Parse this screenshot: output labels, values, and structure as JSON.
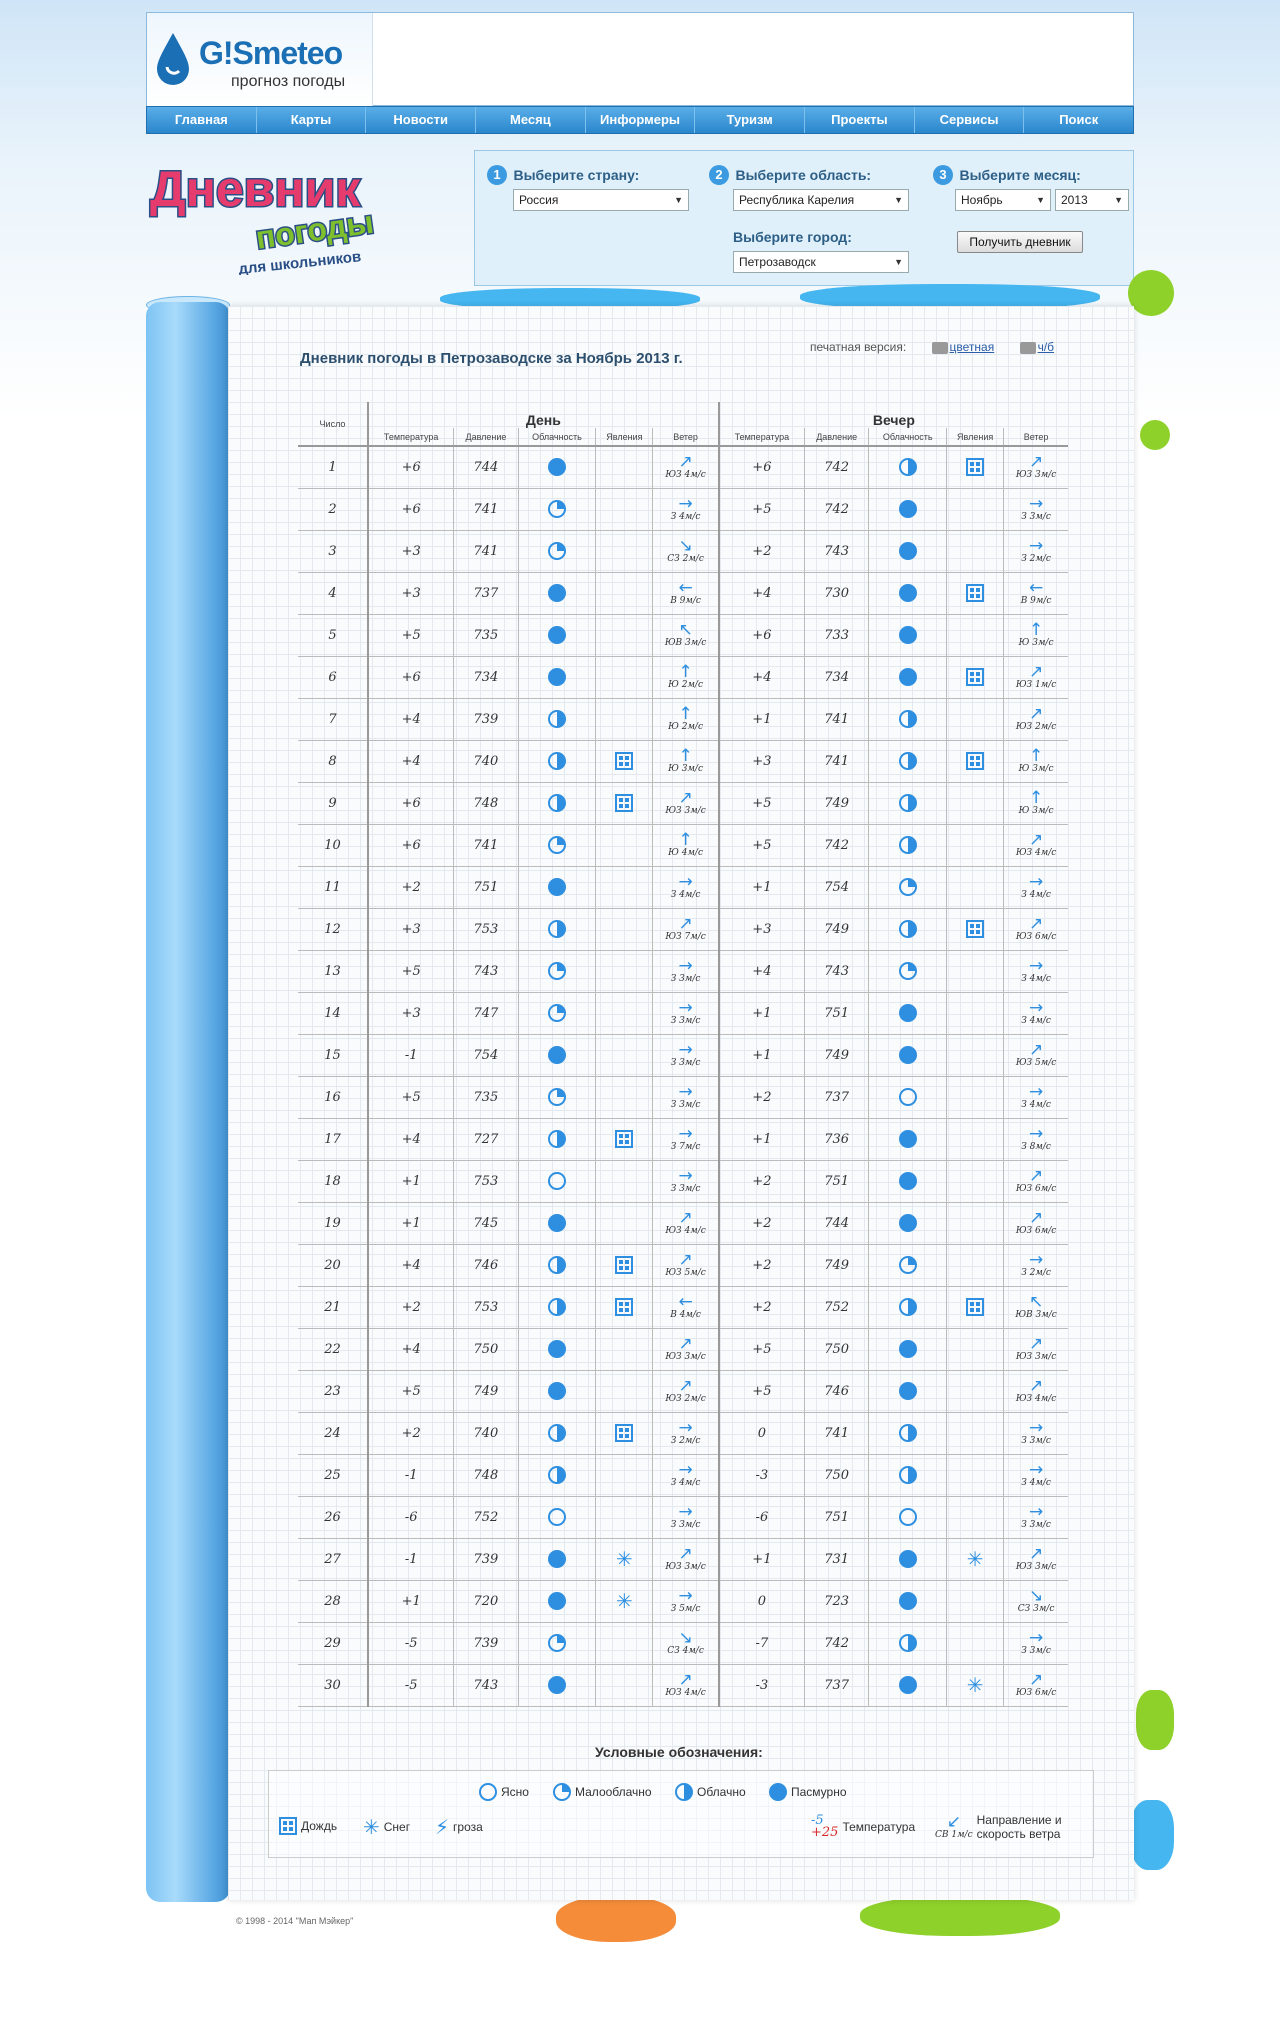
{
  "header": {
    "logo_name": "GISMETEO",
    "logo_brand": "G!Smeteo",
    "logo_sub": "прогноз погоды"
  },
  "nav": [
    "Главная",
    "Карты",
    "Новости",
    "Месяц",
    "Информеры",
    "Туризм",
    "Проекты",
    "Сервисы",
    "Поиск"
  ],
  "diary_logo": {
    "line1": "Дневник",
    "line2": "погоды",
    "line3": "для школьников"
  },
  "selector": {
    "country": {
      "num": "1",
      "title": "Выберите страну:",
      "value": "Россия"
    },
    "region": {
      "num": "2",
      "title": "Выберите область:",
      "value": "Республика Карелия"
    },
    "city": {
      "title": "Выберите город:",
      "value": "Петрозаводск"
    },
    "month": {
      "num": "3",
      "title": "Выберите месяц:",
      "month_value": "Ноябрь",
      "year_value": "2013"
    },
    "submit_label": "Получить дневник"
  },
  "diary": {
    "title": "Дневник погоды в Петрозаводске за Ноябрь 2013 г.",
    "print_label": "печатная версия:",
    "print_color": "цветная",
    "print_bw": "ч/б",
    "col_day": "Число",
    "group_day": "День",
    "group_evening": "Вечер",
    "col_temp": "Температура",
    "col_pressure": "Давление",
    "col_cloud": "Облачность",
    "col_phen": "Явления",
    "col_wind": "Ветер",
    "rows": [
      {
        "d": "1",
        "t1": "+6",
        "p1": "744",
        "c1": "over",
        "ph1": "",
        "w1": "ЮЗ 4м/с",
        "a1": "ne",
        "t2": "+6",
        "p2": "742",
        "c2": "half",
        "ph2": "rain",
        "w2": "ЮЗ 3м/с",
        "a2": "ne"
      },
      {
        "d": "2",
        "t1": "+6",
        "p1": "741",
        "c1": "few",
        "ph1": "",
        "w1": "З 4м/с",
        "a1": "e",
        "t2": "+5",
        "p2": "742",
        "c2": "over",
        "ph2": "",
        "w2": "З 3м/с",
        "a2": "e"
      },
      {
        "d": "3",
        "t1": "+3",
        "p1": "741",
        "c1": "few",
        "ph1": "",
        "w1": "СЗ 2м/с",
        "a1": "se",
        "t2": "+2",
        "p2": "743",
        "c2": "over",
        "ph2": "",
        "w2": "З 2м/с",
        "a2": "e"
      },
      {
        "d": "4",
        "t1": "+3",
        "p1": "737",
        "c1": "over",
        "ph1": "",
        "w1": "В 9м/с",
        "a1": "w",
        "t2": "+4",
        "p2": "730",
        "c2": "over",
        "ph2": "rain",
        "w2": "В 9м/с",
        "a2": "w"
      },
      {
        "d": "5",
        "t1": "+5",
        "p1": "735",
        "c1": "over",
        "ph1": "",
        "w1": "ЮВ 3м/с",
        "a1": "nw",
        "t2": "+6",
        "p2": "733",
        "c2": "over",
        "ph2": "",
        "w2": "Ю 3м/с",
        "a2": "n"
      },
      {
        "d": "6",
        "t1": "+6",
        "p1": "734",
        "c1": "over",
        "ph1": "",
        "w1": "Ю 2м/с",
        "a1": "n",
        "t2": "+4",
        "p2": "734",
        "c2": "over",
        "ph2": "rain",
        "w2": "ЮЗ 1м/с",
        "a2": "ne"
      },
      {
        "d": "7",
        "t1": "+4",
        "p1": "739",
        "c1": "half",
        "ph1": "",
        "w1": "Ю 2м/с",
        "a1": "n",
        "t2": "+1",
        "p2": "741",
        "c2": "half",
        "ph2": "",
        "w2": "ЮЗ 2м/с",
        "a2": "ne"
      },
      {
        "d": "8",
        "t1": "+4",
        "p1": "740",
        "c1": "half",
        "ph1": "rain",
        "w1": "Ю 3м/с",
        "a1": "n",
        "t2": "+3",
        "p2": "741",
        "c2": "half",
        "ph2": "rain",
        "w2": "Ю 3м/с",
        "a2": "n"
      },
      {
        "d": "9",
        "t1": "+6",
        "p1": "748",
        "c1": "half",
        "ph1": "rain",
        "w1": "ЮЗ 3м/с",
        "a1": "ne",
        "t2": "+5",
        "p2": "749",
        "c2": "half",
        "ph2": "",
        "w2": "Ю 3м/с",
        "a2": "n"
      },
      {
        "d": "10",
        "t1": "+6",
        "p1": "741",
        "c1": "few",
        "ph1": "",
        "w1": "Ю 4м/с",
        "a1": "n",
        "t2": "+5",
        "p2": "742",
        "c2": "half",
        "ph2": "",
        "w2": "ЮЗ 4м/с",
        "a2": "ne"
      },
      {
        "d": "11",
        "t1": "+2",
        "p1": "751",
        "c1": "over",
        "ph1": "",
        "w1": "З 4м/с",
        "a1": "e",
        "t2": "+1",
        "p2": "754",
        "c2": "few",
        "ph2": "",
        "w2": "З 4м/с",
        "a2": "e"
      },
      {
        "d": "12",
        "t1": "+3",
        "p1": "753",
        "c1": "half",
        "ph1": "",
        "w1": "ЮЗ 7м/с",
        "a1": "ne",
        "t2": "+3",
        "p2": "749",
        "c2": "half",
        "ph2": "rain",
        "w2": "ЮЗ 6м/с",
        "a2": "ne"
      },
      {
        "d": "13",
        "t1": "+5",
        "p1": "743",
        "c1": "few",
        "ph1": "",
        "w1": "З 3м/с",
        "a1": "e",
        "t2": "+4",
        "p2": "743",
        "c2": "few",
        "ph2": "",
        "w2": "З 4м/с",
        "a2": "e"
      },
      {
        "d": "14",
        "t1": "+3",
        "p1": "747",
        "c1": "few",
        "ph1": "",
        "w1": "З 3м/с",
        "a1": "e",
        "t2": "+1",
        "p2": "751",
        "c2": "over",
        "ph2": "",
        "w2": "З 4м/с",
        "a2": "e"
      },
      {
        "d": "15",
        "t1": "-1",
        "p1": "754",
        "c1": "over",
        "ph1": "",
        "w1": "З 3м/с",
        "a1": "e",
        "t2": "+1",
        "p2": "749",
        "c2": "over",
        "ph2": "",
        "w2": "ЮЗ 5м/с",
        "a2": "ne"
      },
      {
        "d": "16",
        "t1": "+5",
        "p1": "735",
        "c1": "few",
        "ph1": "",
        "w1": "З 3м/с",
        "a1": "e",
        "t2": "+2",
        "p2": "737",
        "c2": "clear",
        "ph2": "",
        "w2": "З 4м/с",
        "a2": "e"
      },
      {
        "d": "17",
        "t1": "+4",
        "p1": "727",
        "c1": "half",
        "ph1": "rain",
        "w1": "З 7м/с",
        "a1": "e",
        "t2": "+1",
        "p2": "736",
        "c2": "over",
        "ph2": "",
        "w2": "З 8м/с",
        "a2": "e"
      },
      {
        "d": "18",
        "t1": "+1",
        "p1": "753",
        "c1": "clear",
        "ph1": "",
        "w1": "З 3м/с",
        "a1": "e",
        "t2": "+2",
        "p2": "751",
        "c2": "over",
        "ph2": "",
        "w2": "ЮЗ 6м/с",
        "a2": "ne"
      },
      {
        "d": "19",
        "t1": "+1",
        "p1": "745",
        "c1": "over",
        "ph1": "",
        "w1": "ЮЗ 4м/с",
        "a1": "ne",
        "t2": "+2",
        "p2": "744",
        "c2": "over",
        "ph2": "",
        "w2": "ЮЗ 6м/с",
        "a2": "ne"
      },
      {
        "d": "20",
        "t1": "+4",
        "p1": "746",
        "c1": "half",
        "ph1": "rain",
        "w1": "ЮЗ 5м/с",
        "a1": "ne",
        "t2": "+2",
        "p2": "749",
        "c2": "few",
        "ph2": "",
        "w2": "З 2м/с",
        "a2": "e"
      },
      {
        "d": "21",
        "t1": "+2",
        "p1": "753",
        "c1": "half",
        "ph1": "rain",
        "w1": "В 4м/с",
        "a1": "w",
        "t2": "+2",
        "p2": "752",
        "c2": "half",
        "ph2": "rain",
        "w2": "ЮВ 3м/с",
        "a2": "nw"
      },
      {
        "d": "22",
        "t1": "+4",
        "p1": "750",
        "c1": "over",
        "ph1": "",
        "w1": "ЮЗ 3м/с",
        "a1": "ne",
        "t2": "+5",
        "p2": "750",
        "c2": "over",
        "ph2": "",
        "w2": "ЮЗ 3м/с",
        "a2": "ne"
      },
      {
        "d": "23",
        "t1": "+5",
        "p1": "749",
        "c1": "over",
        "ph1": "",
        "w1": "ЮЗ 2м/с",
        "a1": "ne",
        "t2": "+5",
        "p2": "746",
        "c2": "over",
        "ph2": "",
        "w2": "ЮЗ 4м/с",
        "a2": "ne"
      },
      {
        "d": "24",
        "t1": "+2",
        "p1": "740",
        "c1": "half",
        "ph1": "rain",
        "w1": "З 2м/с",
        "a1": "e",
        "t2": "0",
        "p2": "741",
        "c2": "half",
        "ph2": "",
        "w2": "З 3м/с",
        "a2": "e"
      },
      {
        "d": "25",
        "t1": "-1",
        "p1": "748",
        "c1": "half",
        "ph1": "",
        "w1": "З 4м/с",
        "a1": "e",
        "t2": "-3",
        "p2": "750",
        "c2": "half",
        "ph2": "",
        "w2": "З 4м/с",
        "a2": "e"
      },
      {
        "d": "26",
        "t1": "-6",
        "p1": "752",
        "c1": "clear",
        "ph1": "",
        "w1": "З 3м/с",
        "a1": "e",
        "t2": "-6",
        "p2": "751",
        "c2": "clear",
        "ph2": "",
        "w2": "З 3м/с",
        "a2": "e"
      },
      {
        "d": "27",
        "t1": "-1",
        "p1": "739",
        "c1": "over",
        "ph1": "snow",
        "w1": "ЮЗ 3м/с",
        "a1": "ne",
        "t2": "+1",
        "p2": "731",
        "c2": "over",
        "ph2": "snow",
        "w2": "ЮЗ 3м/с",
        "a2": "ne"
      },
      {
        "d": "28",
        "t1": "+1",
        "p1": "720",
        "c1": "over",
        "ph1": "snow",
        "w1": "З 5м/с",
        "a1": "e",
        "t2": "0",
        "p2": "723",
        "c2": "over",
        "ph2": "",
        "w2": "СЗ 3м/с",
        "a2": "se"
      },
      {
        "d": "29",
        "t1": "-5",
        "p1": "739",
        "c1": "few",
        "ph1": "",
        "w1": "СЗ 4м/с",
        "a1": "se",
        "t2": "-7",
        "p2": "742",
        "c2": "half",
        "ph2": "",
        "w2": "З 3м/с",
        "a2": "e"
      },
      {
        "d": "30",
        "t1": "-5",
        "p1": "743",
        "c1": "over",
        "ph1": "",
        "w1": "ЮЗ 4м/с",
        "a1": "ne",
        "t2": "-3",
        "p2": "737",
        "c2": "over",
        "ph2": "snow",
        "w2": "ЮЗ 6м/с",
        "a2": "ne"
      }
    ]
  },
  "legend": {
    "title": "Условные обозначения:",
    "clear": "Ясно",
    "few": "Малооблачно",
    "half": "Облачно",
    "over": "Пасмурно",
    "rain": "Дождь",
    "snow": "Снег",
    "storm": "гроза",
    "temp_label": "Температура",
    "temp_neg": "-5",
    "temp_pos": "+25",
    "wind_example": "СВ 1м/с",
    "wind_label": "Направление и скорость ветра"
  },
  "copyright": "© 1998 - 2014 \"Мап Мэйкер\"",
  "colors": {
    "accent": "#2e8fe0",
    "warm": "#d62828",
    "nav": "#2a86cc"
  }
}
